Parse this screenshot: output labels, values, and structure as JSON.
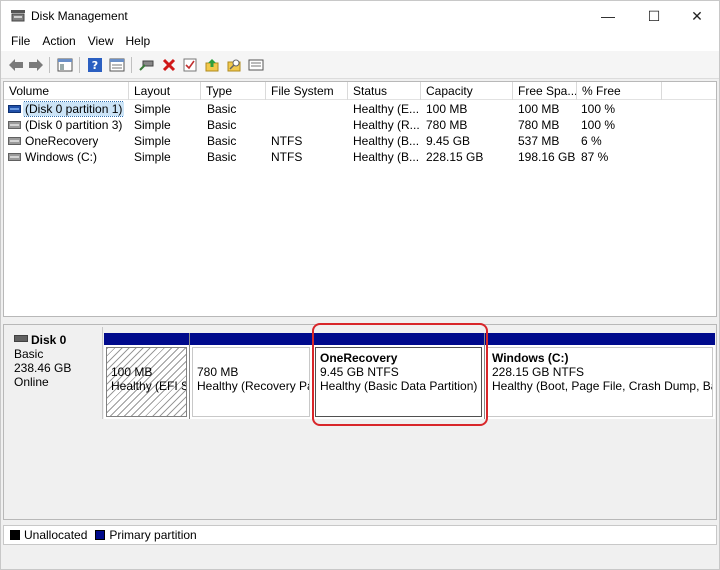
{
  "window": {
    "title": "Disk Management",
    "minimize": "—",
    "maximize": "☐",
    "close": "✕"
  },
  "menu": [
    "File",
    "Action",
    "View",
    "Help"
  ],
  "toolbar": {
    "buttons": [
      "back-icon",
      "forward-icon",
      "console-tree-icon",
      "help-icon",
      "properties-list-icon",
      "connect-icon",
      "delete-icon",
      "check-icon",
      "export-icon",
      "wizard-icon",
      "list-view-icon"
    ]
  },
  "volume_list": {
    "columns": [
      "Volume",
      "Layout",
      "Type",
      "File System",
      "Status",
      "Capacity",
      "Free Spa...",
      "% Free"
    ],
    "rows": [
      {
        "volume": "(Disk 0 partition 1)",
        "layout": "Simple",
        "type": "Basic",
        "fs": "",
        "status": "Healthy (E...",
        "capacity": "100 MB",
        "free": "100 MB",
        "pct": "100 %"
      },
      {
        "volume": "(Disk 0 partition 3)",
        "layout": "Simple",
        "type": "Basic",
        "fs": "",
        "status": "Healthy (R...",
        "capacity": "780 MB",
        "free": "780 MB",
        "pct": "100 %"
      },
      {
        "volume": "OneRecovery",
        "layout": "Simple",
        "type": "Basic",
        "fs": "NTFS",
        "status": "Healthy (B...",
        "capacity": "9.45 GB",
        "free": "537 MB",
        "pct": "6 %"
      },
      {
        "volume": "Windows (C:)",
        "layout": "Simple",
        "type": "Basic",
        "fs": "NTFS",
        "status": "Healthy (B...",
        "capacity": "228.15 GB",
        "free": "198.16 GB",
        "pct": "87 %"
      }
    ]
  },
  "disk": {
    "name": "Disk 0",
    "type": "Basic",
    "size": "238.46 GB",
    "state": "Online",
    "partitions": [
      {
        "name": "",
        "size": "100 MB",
        "status": "Healthy (EFI Sy"
      },
      {
        "name": "",
        "size": "780 MB",
        "status": "Healthy (Recovery Par"
      },
      {
        "name": "OneRecovery",
        "size": "9.45 GB NTFS",
        "status": "Healthy (Basic Data Partition)"
      },
      {
        "name": "Windows  (C:)",
        "size": "228.15 GB NTFS",
        "status": "Healthy (Boot, Page File, Crash Dump, Basic"
      }
    ]
  },
  "legend": [
    {
      "label": "Unallocated",
      "color": "#000000"
    },
    {
      "label": "Primary partition",
      "color": "#000a8c"
    }
  ]
}
